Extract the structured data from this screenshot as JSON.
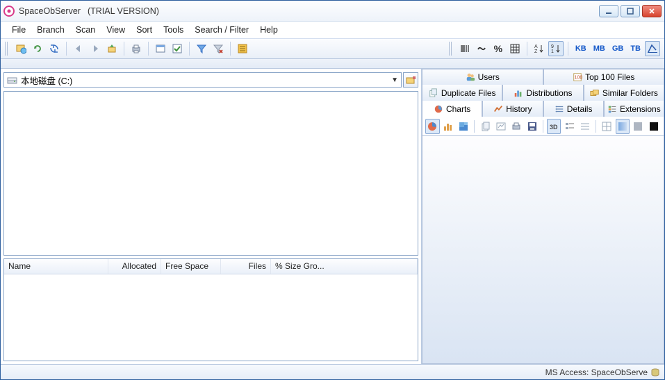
{
  "title": {
    "app": "SpaceObServer",
    "trial": "(TRIAL VERSION)"
  },
  "menu": [
    "File",
    "Branch",
    "Scan",
    "View",
    "Sort",
    "Tools",
    "Search / Filter",
    "Help"
  ],
  "units": [
    "KB",
    "MB",
    "GB",
    "TB"
  ],
  "drive": {
    "label": "本地磁盘 (C:)"
  },
  "columns": {
    "name": "Name",
    "allocated": "Allocated",
    "free": "Free Space",
    "files": "Files",
    "sizegrow": "% Size Gro..."
  },
  "tabs_top": {
    "users": "Users",
    "top100": "Top 100 Files"
  },
  "tabs_mid": {
    "dup": "Duplicate Files",
    "dist": "Distributions",
    "sim": "Similar Folders"
  },
  "tabs_bot": {
    "charts": "Charts",
    "history": "History",
    "details": "Details",
    "ext": "Extensions"
  },
  "status": {
    "db": "MS Access: SpaceObServe"
  }
}
